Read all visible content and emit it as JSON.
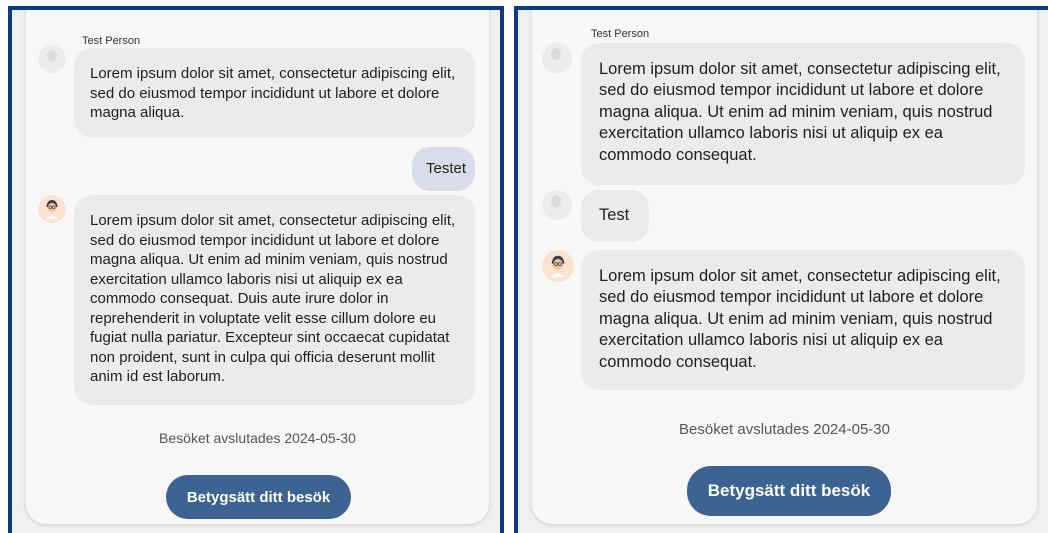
{
  "left": {
    "sender_name": "Test Person",
    "messages": [
      {
        "direction": "incoming",
        "avatar": "person-placeholder-icon",
        "text": "Lorem ipsum dolor sit amet, consectetur adipiscing elit, sed do eiusmod tempor incididunt ut labore et dolore magna aliqua."
      },
      {
        "direction": "outgoing",
        "text": "Testet"
      },
      {
        "direction": "incoming",
        "avatar": "doctor-avatar-icon",
        "text": "Lorem ipsum dolor sit amet, consectetur adipiscing elit, sed do eiusmod tempor incididunt ut labore et dolore magna aliqua. Ut enim ad minim veniam, quis nostrud exercitation ullamco laboris nisi ut aliquip ex ea commodo consequat. Duis aute irure dolor in reprehenderit in voluptate velit esse cillum dolore eu fugiat nulla pariatur. Excepteur sint occaecat cupidatat non proident, sunt in culpa qui officia deserunt mollit anim id est laborum."
      }
    ],
    "status_text": "Besöket avslutades 2024-05-30",
    "rate_button_label": "Betygsätt ditt besök"
  },
  "right": {
    "sender_name": "Test Person",
    "messages": [
      {
        "direction": "incoming",
        "avatar": "person-placeholder-icon",
        "text": "Lorem ipsum dolor sit amet, consectetur adipiscing elit, sed do eiusmod tempor incididunt ut labore et dolore magna aliqua. Ut enim ad minim veniam, quis nostrud exercitation ullamco laboris nisi ut aliquip ex ea commodo consequat."
      },
      {
        "direction": "incoming",
        "avatar": "person-placeholder-icon",
        "text": "Test"
      },
      {
        "direction": "incoming",
        "avatar": "doctor-avatar-icon",
        "text": "Lorem ipsum dolor sit amet, consectetur adipiscing elit, sed do eiusmod tempor incididunt ut labore et dolore magna aliqua. Ut enim ad minim veniam, quis nostrud exercitation ullamco laboris nisi ut aliquip ex ea commodo consequat."
      }
    ],
    "status_text": "Besöket avslutades 2024-05-30",
    "rate_button_label": "Betygsätt ditt besök"
  },
  "colors": {
    "frame_border": "#0e3a82",
    "incoming_bubble": "#ebebeb",
    "outgoing_bubble": "#d9dde9",
    "button": "#3d6393"
  }
}
